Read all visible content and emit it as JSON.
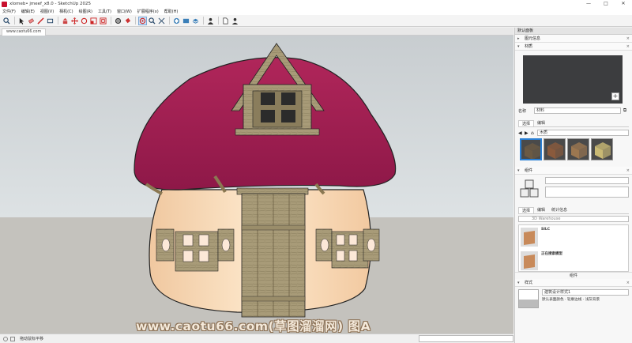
{
  "window": {
    "title": "xlomeb• jmeef_x8.0 - SketchUp 2025",
    "controls": [
      "—",
      "□",
      "✕"
    ]
  },
  "menu": [
    "文件(F)",
    "编辑(E)",
    "视图(V)",
    "相机(C)",
    "绘图(R)",
    "工具(T)",
    "窗口(W)",
    "扩展程序(x)",
    "帮助(H)"
  ],
  "toolbar_icons": [
    "search-icon",
    "select-arrow-icon",
    "eraser-icon",
    "pencil-icon",
    "rectangle-icon",
    "move-icon",
    "push-pull-icon",
    "rotate-icon",
    "scale-icon",
    "offset-icon",
    "tape-icon",
    "paint-bucket-icon",
    "orbit-icon",
    "pan-icon",
    "zoom-icon",
    "zoom-extents-icon",
    "warehouse-icon",
    "extension-icon",
    "layers-icon",
    "person-icon",
    "document-icon",
    "share-icon"
  ],
  "doc_tab": "www.caotu66.com",
  "watermark": "www.caotu66.com(草图溜溜网) 图A",
  "status": {
    "text": "拖动鼠标平移",
    "measure_label": ""
  },
  "tray": {
    "title": "默认面板",
    "entity_info": "图元信息",
    "materials": {
      "header": "材质",
      "name_label": "名称",
      "name_value": "材料",
      "tabs": [
        "选择",
        "编辑"
      ],
      "library": "木质",
      "swatch_colors": [
        "#6b5a44",
        "#8a5a3c",
        "#9c7750",
        "#c9b974"
      ]
    },
    "components": {
      "header": "组件",
      "tabs": [
        "选择",
        "编辑",
        "统计信息"
      ],
      "search_placeholder": "3D Warehouse",
      "items": [
        "SILC",
        "正在搜索模型",
        "草图溜溜"
      ],
      "footer": "组件"
    },
    "styles": {
      "header": "样式",
      "name": "建筑设计样式1",
      "desc": "默认表面颜色 · 轮廓边线 · 浅灰背景"
    }
  }
}
